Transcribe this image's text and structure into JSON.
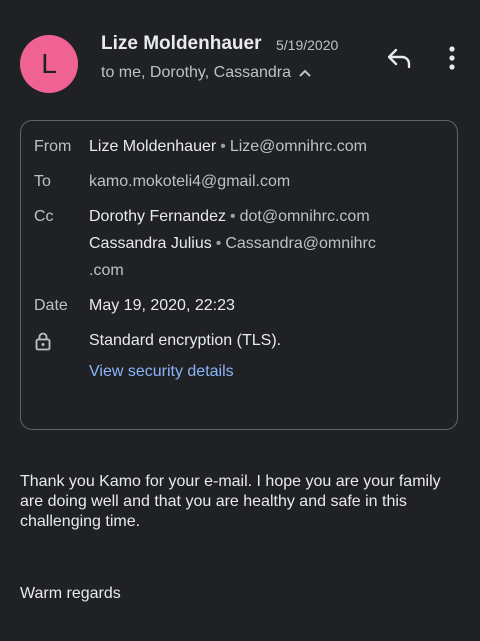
{
  "header": {
    "avatar_letter": "L",
    "avatar_color": "#f06292",
    "sender_name": "Lize Moldenhauer",
    "date": "5/19/2020",
    "recipients_summary": "to me, Dorothy, Cassandra",
    "icons": [
      "reply-icon",
      "more-vert-icon",
      "chevron-up-icon"
    ]
  },
  "details": {
    "from_label": "From",
    "from_name": "Lize Moldenhauer",
    "from_email": "Lize@omnihrc.com",
    "to_label": "To",
    "to_email": "kamo.mokoteli4@gmail.com",
    "cc_label": "Cc",
    "cc": [
      {
        "name": "Dorothy Fernandez",
        "email": "dot@omnihrc.com"
      },
      {
        "name": "Cassandra Julius",
        "email": "Cassandra@omnihrc",
        "email_cont": ".com"
      }
    ],
    "date_label": "Date",
    "date_value": "May 19, 2020, 22:23",
    "security_text": "Standard encryption (TLS).",
    "security_link": "View security details"
  },
  "body": {
    "paragraph": "Thank you Kamo for your e-mail. I hope you are your family are doing well and that you are healthy and safe in this challenging time.",
    "signoff": "Warm regards"
  },
  "colors": {
    "background": "#202124",
    "text": "#e8eaed",
    "secondary": "#bdc1c6",
    "link": "#8ab4f8",
    "border": "#5f6368"
  }
}
